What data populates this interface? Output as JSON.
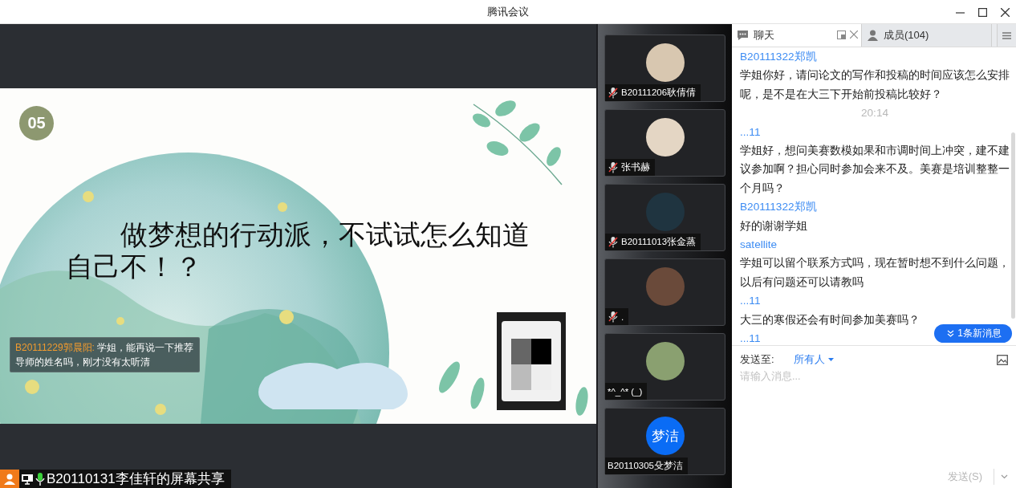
{
  "window": {
    "title": "腾讯会议"
  },
  "slide": {
    "number": "05",
    "headline": "做梦想的行动派，不试试怎么知道自己不！？",
    "chat_popup": {
      "sender": "B20111229郭晨阳:",
      "message": "学姐，能再说一下推荐导师的姓名吗，刚才没有太听清"
    }
  },
  "screen_share": {
    "label": "B20110131李佳轩的屏幕共享"
  },
  "participants": [
    {
      "name": "B20111206耿倩倩",
      "muted": true,
      "kind": "photo"
    },
    {
      "name": "张书赫",
      "muted": true,
      "kind": "photo"
    },
    {
      "name": "B20111013张金蒸",
      "muted": true,
      "kind": "photo"
    },
    {
      "name": ".",
      "muted": true,
      "kind": "photo"
    },
    {
      "name": "*^_^* (_)",
      "muted": false,
      "kind": "photo"
    },
    {
      "name": "B20110305殳梦洁",
      "muted": false,
      "kind": "initials",
      "initials": "梦洁"
    }
  ],
  "chat": {
    "tabs": [
      {
        "label": "聊天",
        "selected": true
      },
      {
        "label": "成员(104)",
        "selected": false
      }
    ],
    "messages": [
      {
        "kind": "sender",
        "text": "B20111322郑凯"
      },
      {
        "kind": "text",
        "text": "学姐你好，请问论文的写作和投稿的时间应该怎么安排呢，是不是在大三下开始前投稿比较好？"
      },
      {
        "kind": "time",
        "text": "20:14"
      },
      {
        "kind": "sender",
        "text": "...11"
      },
      {
        "kind": "text",
        "text": "学姐好，想问美赛数模如果和市调时间上冲突，建不建议参加啊？担心同时参加会来不及。美赛是培训整整一个月吗？"
      },
      {
        "kind": "sender",
        "text": "B20111322郑凯"
      },
      {
        "kind": "text",
        "text": "好的谢谢学姐"
      },
      {
        "kind": "sender",
        "text": "satellite"
      },
      {
        "kind": "text",
        "text": "学姐可以留个联系方式吗，现在暂时想不到什么问题，以后有问题还可以请教吗"
      },
      {
        "kind": "sender",
        "text": "...11"
      },
      {
        "kind": "text",
        "text": "大三的寒假还会有时间参加美赛吗？"
      },
      {
        "kind": "sender",
        "text": "...11"
      }
    ],
    "new_messages": "1条新消息",
    "compose": {
      "send_to_label": "发送至:",
      "recipient": "所有人",
      "placeholder": "请输入消息...",
      "send_button": {
        "label": "发送(S)",
        "disabled": true
      }
    }
  }
}
